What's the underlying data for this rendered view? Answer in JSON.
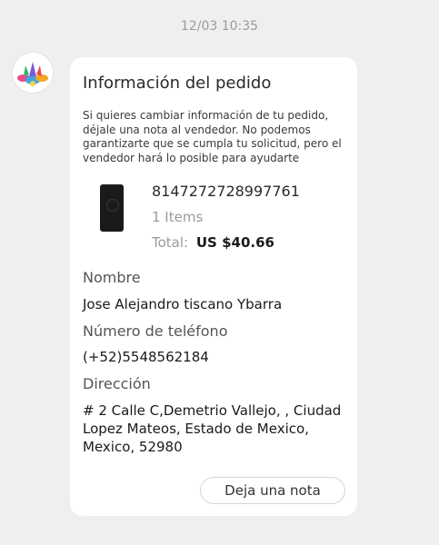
{
  "chat": {
    "timestamp": "12/03 10:35"
  },
  "order_card": {
    "title": "Información del pedido",
    "description": "Si quieres cambiar información de tu pedido, déjale una nota al vendedor. No podemos garantizarte que se cumpla tu solicitud, pero el vendedor hará lo posible para ayudarte",
    "product": {
      "order_number": "8147272728997761",
      "items": "1 Items",
      "total_label": "Total:",
      "total_value": "US $40.66"
    },
    "fields": [
      {
        "label": "Nombre",
        "value": "Jose Alejandro tiscano Ybarra"
      },
      {
        "label": "Número de teléfono",
        "value": "(+52)5548562184"
      },
      {
        "label": "Dirección",
        "value": "# 2 Calle C,Demetrio Vallejo, , Ciudad Lopez Mateos, Estado de Mexico, Mexico, 52980"
      }
    ],
    "note_button_label": "Deja una nota"
  }
}
